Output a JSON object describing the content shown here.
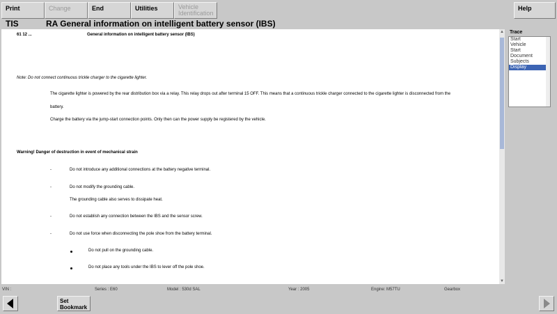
{
  "toolbar": {
    "print": "Print",
    "change": "Change",
    "end": "End",
    "utilities": "Utilities",
    "vehicle_id_line1": "Vehicle",
    "vehicle_id_line2": "Identification",
    "help": "Help"
  },
  "header": {
    "app": "TIS",
    "title": "RA  General information on intelligent battery sensor (IBS)"
  },
  "document": {
    "ref": "61 12 ...",
    "heading": "General information on intelligent battery sensor (IBS)",
    "note": "Note: Do not connect continuous trickle charger to the cigarette lighter.",
    "para1": "The cigarette lighter is powered by the rear distribution box via a relay. This relay drops out after terminal 15 OFF. This means that a continuous trickle charger connected to the cigarette lighter is disconnected from the",
    "para1_cont": "battery.",
    "para2": "Charge the battery via the jump-start connection points. Only then can the power supply be registered by the vehicle.",
    "warning": "Warning! Danger of destruction in event of mechanical strain",
    "dash": "-",
    "item1": "Do not introduce any additional connections at the battery negative terminal.",
    "item2": "Do not modify the grounding cable.",
    "item2_sub": "The grounding cable also serves to dissipate heat.",
    "item3": "Do not establish any connection between the IBS and the sensor screw.",
    "item4": "Do not use force when disconnecting the pole shoe from the battery terminal.",
    "bullet1": "Do not pull on the grounding cable.",
    "bullet2": "Do not place any tools under the IBS to lever off the pole shoe."
  },
  "trace": {
    "label": "Trace",
    "items": [
      "Start",
      "Vehicle",
      "Start",
      "Document",
      "Subjects",
      "Display"
    ],
    "selected": "Display"
  },
  "status": {
    "vin": "VIN :",
    "series": "Series : E60",
    "model": "Model : 530d SAL",
    "year": "Year : 2005",
    "engine": "Engine: M57TU",
    "gearbox": "Gearbox"
  },
  "bottom": {
    "bookmark_line1": "Set",
    "bookmark_line2": "Bookmark"
  },
  "colors": {
    "selection": "#3c64b4",
    "nav_arrow_active": "#000000",
    "nav_arrow_inactive": "#8a8a8a"
  }
}
